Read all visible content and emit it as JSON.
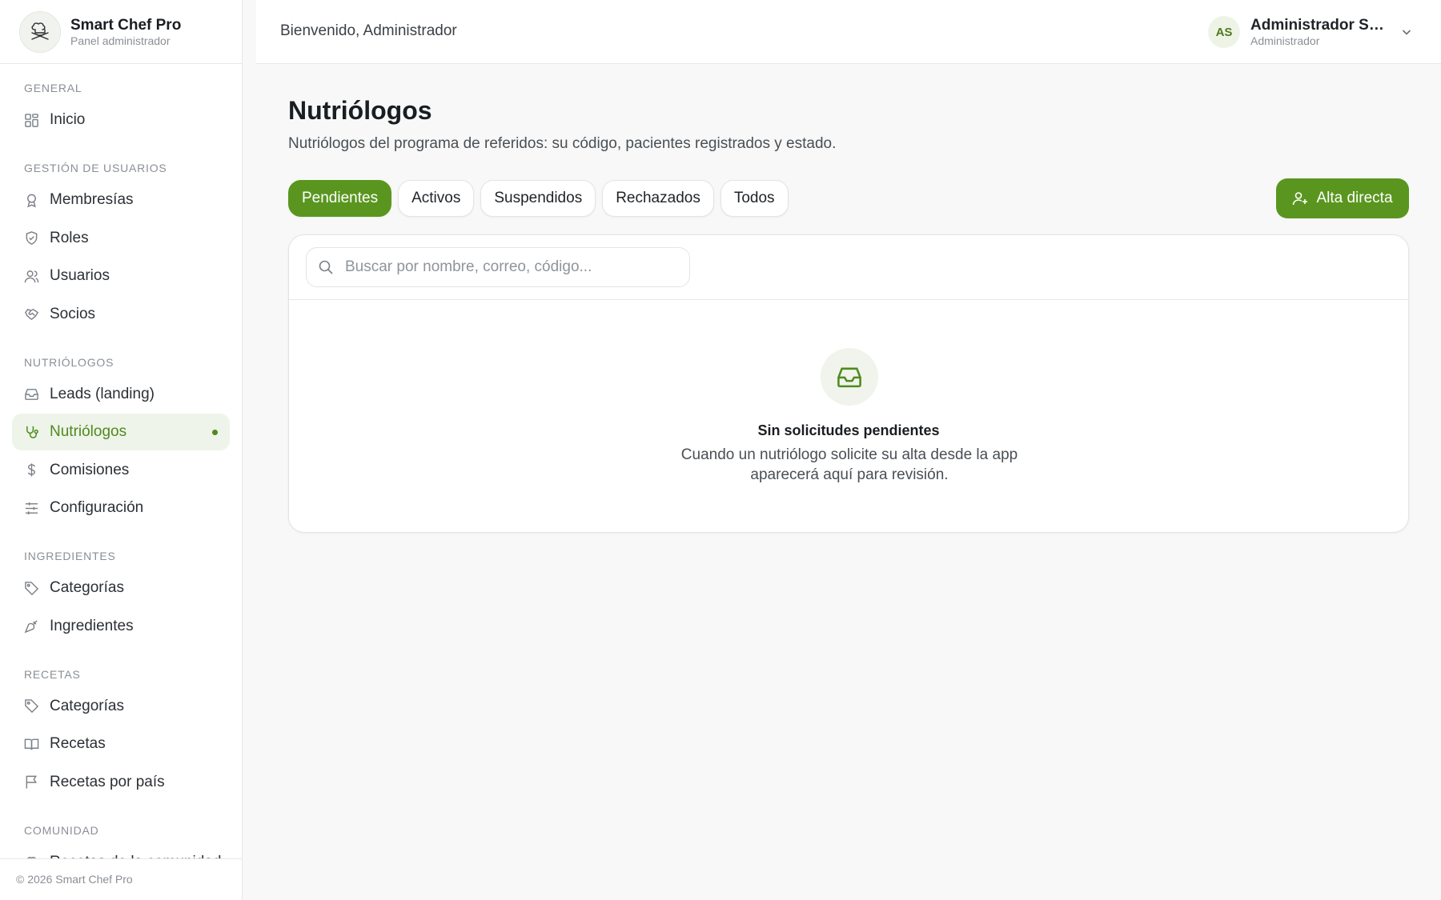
{
  "brand": {
    "name": "Smart Chef Pro",
    "subtitle": "Panel administrador"
  },
  "topbar": {
    "welcome": "Bienvenido, Administrador",
    "user_initials": "AS",
    "user_name": "Administrador Smart Chef",
    "user_role": "Administrador"
  },
  "sidebar": {
    "sections": [
      {
        "label": "GENERAL",
        "items": [
          {
            "label": "Inicio",
            "icon": "dashboard-icon"
          }
        ]
      },
      {
        "label": "GESTIÓN DE USUARIOS",
        "items": [
          {
            "label": "Membresías",
            "icon": "award-icon"
          },
          {
            "label": "Roles",
            "icon": "shield-icon"
          },
          {
            "label": "Usuarios",
            "icon": "users-icon"
          },
          {
            "label": "Socios",
            "icon": "handshake-icon"
          }
        ]
      },
      {
        "label": "NUTRIÓLOGOS",
        "items": [
          {
            "label": "Leads (landing)",
            "icon": "inbox-icon"
          },
          {
            "label": "Nutriólogos",
            "icon": "stethoscope-icon",
            "active": true
          },
          {
            "label": "Comisiones",
            "icon": "dollar-icon"
          },
          {
            "label": "Configuración",
            "icon": "sliders-icon"
          }
        ]
      },
      {
        "label": "INGREDIENTES",
        "items": [
          {
            "label": "Categorías",
            "icon": "tag-icon"
          },
          {
            "label": "Ingredientes",
            "icon": "carrot-icon"
          }
        ]
      },
      {
        "label": "RECETAS",
        "items": [
          {
            "label": "Categorías",
            "icon": "tag-icon"
          },
          {
            "label": "Recetas",
            "icon": "book-icon"
          },
          {
            "label": "Recetas por país",
            "icon": "flag-icon"
          }
        ]
      },
      {
        "label": "COMUNIDAD",
        "items": [
          {
            "label": "Recetas de la comunidad",
            "icon": "chef-hat-icon"
          }
        ]
      }
    ],
    "footer": "© 2026 Smart Chef Pro"
  },
  "main": {
    "title": "Nutriólogos",
    "subtitle": "Nutriólogos del programa de referidos: su código, pacientes registrados y estado.",
    "tabs": [
      "Pendientes",
      "Activos",
      "Suspendidos",
      "Rechazados",
      "Todos"
    ],
    "active_tab": "Pendientes",
    "primary_action": "Alta directa",
    "search": {
      "placeholder": "Buscar por nombre, correo, código...",
      "value": ""
    },
    "empty": {
      "title": "Sin solicitudes pendientes",
      "text": "Cuando un nutriólogo solicite su alta desde la app aparecerá aquí para revisión."
    }
  },
  "colors": {
    "accent": "#5a961f",
    "accent_light": "#eef4e9",
    "background": "#f7f8f7"
  }
}
